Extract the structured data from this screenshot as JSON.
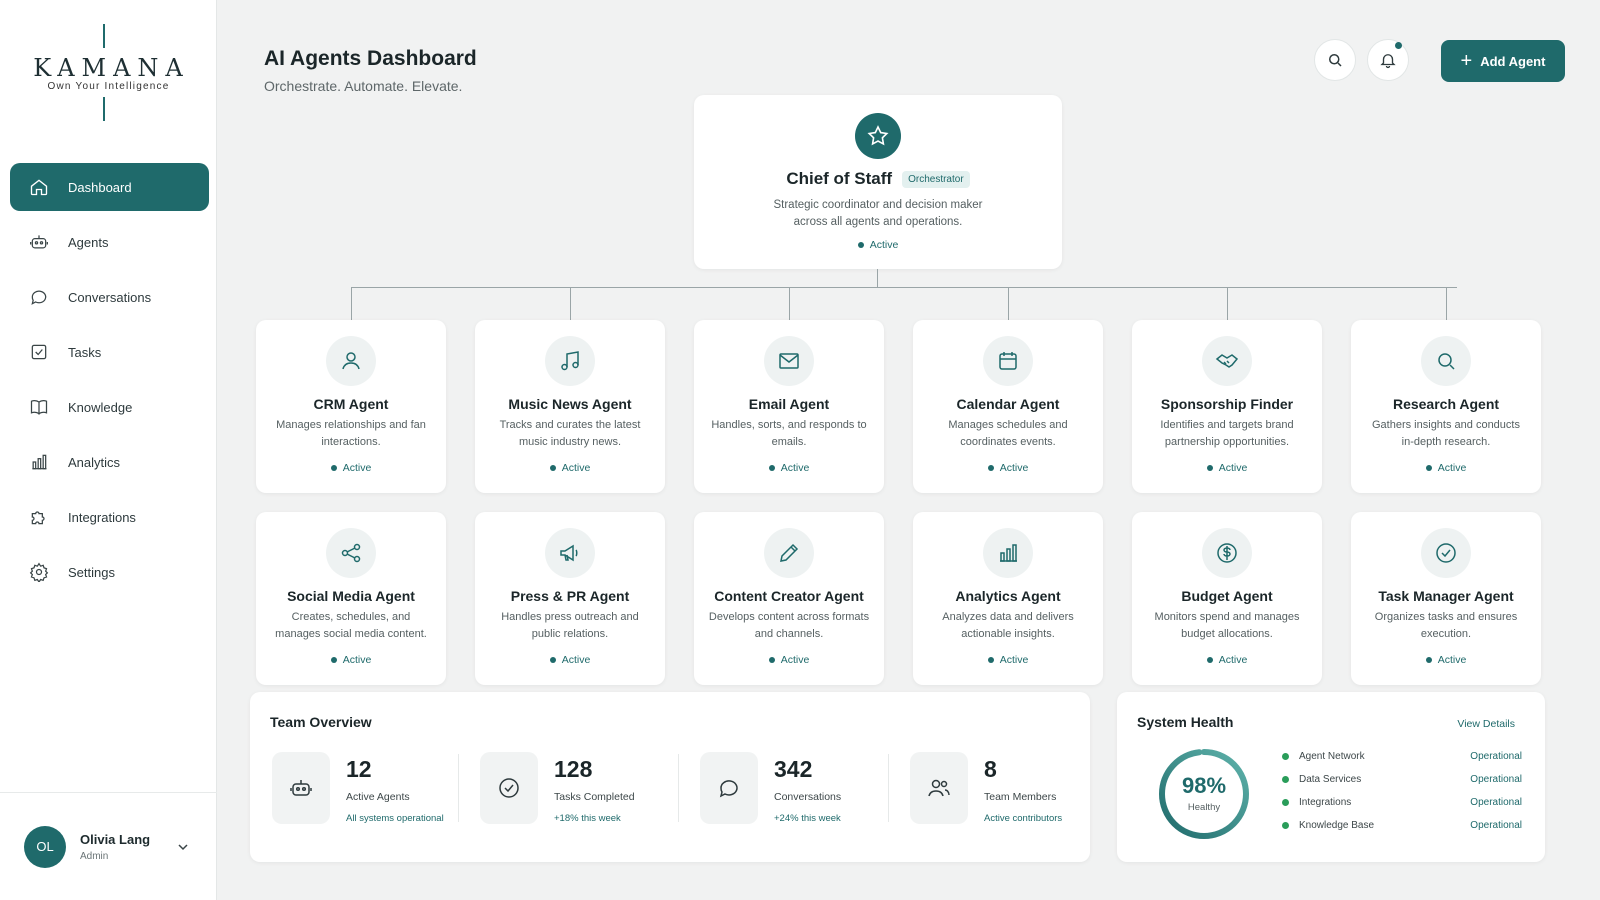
{
  "brand": {
    "name": "KAMANA",
    "tagline": "Own Your Intelligence"
  },
  "nav": [
    {
      "label": "Dashboard",
      "icon": "home-icon"
    },
    {
      "label": "Agents",
      "icon": "robot-icon"
    },
    {
      "label": "Conversations",
      "icon": "chat-icon"
    },
    {
      "label": "Tasks",
      "icon": "checkbox-icon"
    },
    {
      "label": "Knowledge",
      "icon": "book-icon"
    },
    {
      "label": "Analytics",
      "icon": "bar-chart-icon"
    },
    {
      "label": "Integrations",
      "icon": "puzzle-icon"
    },
    {
      "label": "Settings",
      "icon": "gear-icon"
    }
  ],
  "user": {
    "initials": "OL",
    "name": "Olivia Lang",
    "role": "Admin"
  },
  "header": {
    "title": "AI Agents Dashboard",
    "subtitle": "Orchestrate. Automate. Elevate.",
    "add_label": "Add Agent"
  },
  "chief": {
    "name": "Chief of Staff",
    "badge": "Orchestrator",
    "desc1": "Strategic coordinator and decision maker",
    "desc2": "across all agents and operations.",
    "status": "Active"
  },
  "agents": [
    {
      "name": "CRM Agent",
      "desc": "Manages relationships and fan interactions.",
      "status": "Active",
      "icon": "user-icon"
    },
    {
      "name": "Music News Agent",
      "desc": "Tracks and curates the latest music industry news.",
      "status": "Active",
      "icon": "music-note-icon"
    },
    {
      "name": "Email Agent",
      "desc": "Handles, sorts, and responds to emails.",
      "status": "Active",
      "icon": "mail-icon"
    },
    {
      "name": "Calendar Agent",
      "desc": "Manages schedules and coordinates events.",
      "status": "Active",
      "icon": "calendar-icon"
    },
    {
      "name": "Sponsorship Finder",
      "desc": "Identifies and targets brand partnership opportunities.",
      "status": "Active",
      "icon": "handshake-icon"
    },
    {
      "name": "Research Agent",
      "desc": "Gathers insights and conducts in-depth research.",
      "status": "Active",
      "icon": "search-icon"
    },
    {
      "name": "Social Media Agent",
      "desc": "Creates, schedules, and manages social media content.",
      "status": "Active",
      "icon": "share-icon"
    },
    {
      "name": "Press & PR Agent",
      "desc": "Handles press outreach and public relations.",
      "status": "Active",
      "icon": "megaphone-icon"
    },
    {
      "name": "Content Creator Agent",
      "desc": "Develops content across formats and channels.",
      "status": "Active",
      "icon": "pencil-icon"
    },
    {
      "name": "Analytics Agent",
      "desc": "Analyzes data and delivers actionable insights.",
      "status": "Active",
      "icon": "bar-chart-icon"
    },
    {
      "name": "Budget Agent",
      "desc": "Monitors spend and manages budget allocations.",
      "status": "Active",
      "icon": "dollar-icon"
    },
    {
      "name": "Task Manager Agent",
      "desc": "Organizes tasks and ensures execution.",
      "status": "Active",
      "icon": "check-circle-icon"
    }
  ],
  "team": {
    "title": "Team Overview",
    "stats": [
      {
        "value": "12",
        "label": "Active Agents",
        "sub": "All systems operational",
        "icon": "robot-icon"
      },
      {
        "value": "128",
        "label": "Tasks Completed",
        "sub": "+18% this week",
        "icon": "check-circle-icon"
      },
      {
        "value": "342",
        "label": "Conversations",
        "sub": "+24% this week",
        "icon": "chat-icon"
      },
      {
        "value": "8",
        "label": "Team Members",
        "sub": "Active contributors",
        "icon": "users-icon"
      }
    ]
  },
  "health": {
    "title": "System Health",
    "view": "View Details",
    "value": "98%",
    "percent": 98,
    "label": "Healthy",
    "items": [
      {
        "name": "Agent Network",
        "status": "Operational"
      },
      {
        "name": "Data Services",
        "status": "Operational"
      },
      {
        "name": "Integrations",
        "status": "Operational"
      },
      {
        "name": "Knowledge Base",
        "status": "Operational"
      }
    ]
  },
  "colors": {
    "accent": "#1f6a6b",
    "ok": "#2a9d5a"
  }
}
